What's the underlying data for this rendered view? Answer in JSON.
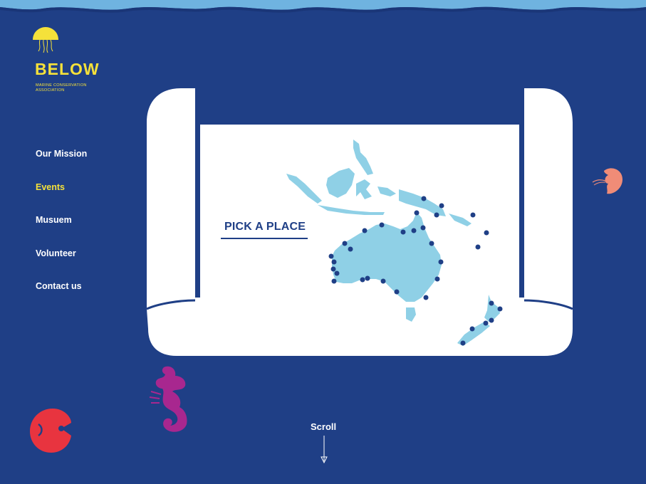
{
  "brand": {
    "name": "BELOW",
    "subtitle": "MARINE CONSERVATION ASSOCIATION"
  },
  "nav": {
    "items": [
      {
        "label": "Our Mission",
        "active": false
      },
      {
        "label": "Events",
        "active": true
      },
      {
        "label": "Musuem",
        "active": false
      },
      {
        "label": "Volunteer",
        "active": false
      },
      {
        "label": "Contact us",
        "active": false
      }
    ]
  },
  "map": {
    "heading": "PICK A PLACE",
    "marker_color": "#1f3f86",
    "land_color": "#8fd0e6"
  },
  "scroll": {
    "label": "Scroll"
  },
  "colors": {
    "background": "#1f3f86",
    "accent": "#f5e13a",
    "paper": "#ffffff",
    "water": "#6fb3e0"
  },
  "icons": [
    "jellyfish-icon",
    "seahorse-icon",
    "red-fish-icon",
    "pink-fish-icon",
    "arrow-down-icon"
  ]
}
